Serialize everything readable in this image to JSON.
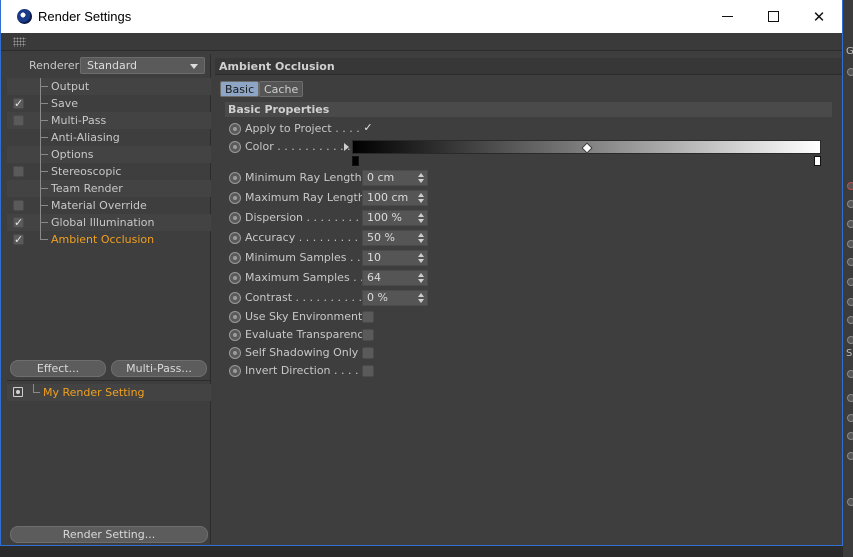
{
  "window": {
    "title": "Render Settings",
    "close_glyph": "✕"
  },
  "left": {
    "renderer_label": "Renderer",
    "renderer_value": "Standard",
    "tree": [
      {
        "label": "Output",
        "check": "none",
        "active": false
      },
      {
        "label": "Save",
        "check": "checked",
        "active": false
      },
      {
        "label": "Multi-Pass",
        "check": "unchecked",
        "active": false
      },
      {
        "label": "Anti-Aliasing",
        "check": "none",
        "active": false
      },
      {
        "label": "Options",
        "check": "none",
        "active": false
      },
      {
        "label": "Stereoscopic",
        "check": "unchecked",
        "active": false
      },
      {
        "label": "Team Render",
        "check": "none",
        "active": false
      },
      {
        "label": "Material Override",
        "check": "unchecked",
        "active": false
      },
      {
        "label": "Global Illumination",
        "check": "checked",
        "active": false
      },
      {
        "label": "Ambient Occlusion",
        "check": "checked",
        "active": true
      }
    ],
    "effect_button": "Effect...",
    "multipass_button": "Multi-Pass...",
    "render_setting_item": "My Render Setting",
    "render_setting_button": "Render Setting..."
  },
  "right": {
    "section_title": "Ambient Occlusion",
    "tabs": {
      "basic": "Basic",
      "cache": "Cache"
    },
    "sub_title": "Basic Properties",
    "apply_label": "Apply to Project . . . .",
    "color_label": "Color . . . . . . . . . . . .",
    "params_num": [
      {
        "label": "Minimum Ray Length",
        "value": "0 cm"
      },
      {
        "label": "Maximum Ray Length",
        "value": "100 cm"
      },
      {
        "label": "Dispersion . . . . . . . . .",
        "value": "100 %"
      },
      {
        "label": "Accuracy . . . . . . . . . . .",
        "value": "50 %"
      },
      {
        "label": "Minimum Samples . .",
        "value": "10"
      },
      {
        "label": "Maximum Samples . .",
        "value": "64"
      },
      {
        "label": "Contrast . . . . . . . . . . .",
        "value": "0 %"
      }
    ],
    "params_bool": [
      {
        "label": "Use Sky Environment",
        "checked": false
      },
      {
        "label": "Evaluate Transparency",
        "checked": false
      },
      {
        "label": "Self Shadowing Only",
        "checked": false
      },
      {
        "label": "Invert Direction . . . . .",
        "checked": false
      }
    ],
    "gradient_knot_position": 0.5,
    "check_glyph": "✓"
  },
  "colors": {
    "accent_orange": "#f0a020",
    "tab_active": "#8ea6c6",
    "window_border": "#2f6fd0"
  },
  "icons": [
    "app-icon",
    "minimize-icon",
    "maximize-icon",
    "close-icon",
    "grip-icon",
    "dropdown-caret-icon",
    "settings-icon",
    "radio-icon",
    "gradient-arrow-icon"
  ]
}
